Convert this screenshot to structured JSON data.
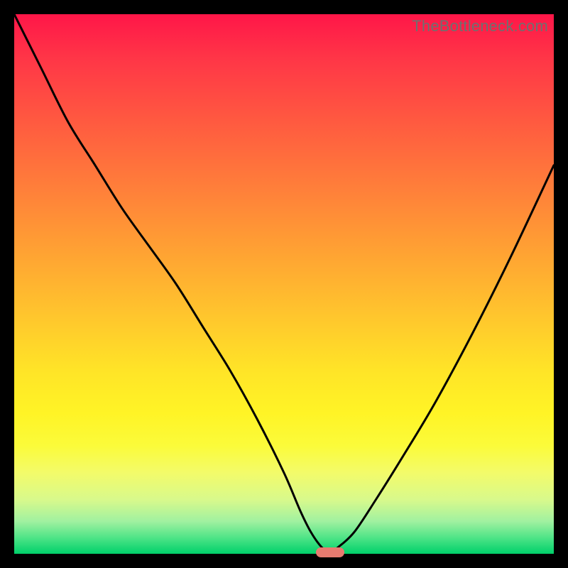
{
  "watermark": "TheBottleneck.com",
  "colors": {
    "curve": "#000000",
    "marker": "#e77b70",
    "background_frame": "#000000"
  },
  "chart_data": {
    "type": "line",
    "title": "",
    "xlabel": "",
    "ylabel": "",
    "xlim": [
      0,
      100
    ],
    "ylim": [
      0,
      100
    ],
    "x": [
      0,
      5,
      10,
      15,
      20,
      25,
      30,
      35,
      40,
      45,
      50,
      53,
      55,
      57,
      58.5,
      60,
      63,
      67,
      72,
      78,
      85,
      92,
      100
    ],
    "values": [
      100,
      90,
      80,
      72,
      64,
      57,
      50,
      42,
      34,
      25,
      15,
      8,
      4,
      1.2,
      0.3,
      1.2,
      4,
      10,
      18,
      28,
      41,
      55,
      72
    ],
    "marker": {
      "x": 58.5,
      "y": 0.3
    },
    "note": "Values are read off the figure in percentage units; V-shaped bottleneck curve with minimum near x≈58.5."
  }
}
